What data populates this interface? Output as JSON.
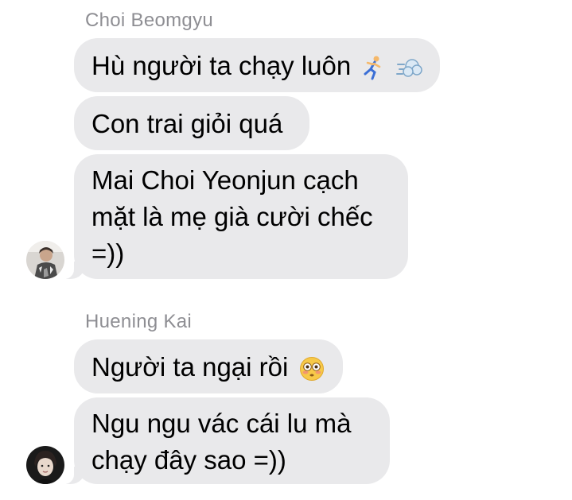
{
  "groups": [
    {
      "sender": "Choi Beomgyu",
      "messages": [
        {
          "text": "Hù người ta chạy luôn",
          "emojis": [
            "running-person",
            "dash-cloud"
          ]
        },
        {
          "text": "Con trai giỏi quá"
        },
        {
          "lines": [
            "Mai Choi Yeonjun cạch",
            "mặt là mẹ già cười chếc",
            "=))"
          ]
        }
      ]
    },
    {
      "sender": "Huening Kai",
      "messages": [
        {
          "text": "Người ta ngại rồi",
          "emojis": [
            "flushed-face"
          ]
        },
        {
          "lines": [
            "Ngu ngu vác cái lu mà",
            "chạy đây sao =))"
          ]
        }
      ]
    }
  ],
  "colors": {
    "bubble": "#e9e9eb",
    "sender_name": "#8e8e93",
    "text": "#000000"
  }
}
